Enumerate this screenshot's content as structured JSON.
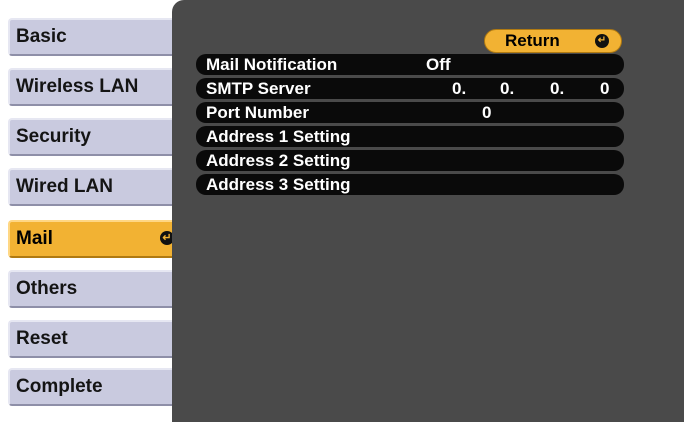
{
  "sidebar": {
    "items": [
      {
        "label": "Basic"
      },
      {
        "label": "Wireless LAN"
      },
      {
        "label": "Security"
      },
      {
        "label": "Wired LAN"
      },
      {
        "label": "Mail"
      },
      {
        "label": "Others"
      },
      {
        "label": "Reset"
      },
      {
        "label": "Complete"
      }
    ],
    "active_index": 4,
    "enter_icon": "enter-icon"
  },
  "panel": {
    "return_label": "Return",
    "return_icon": "return-icon",
    "rows": [
      {
        "label": "Mail Notification",
        "value": "Off"
      },
      {
        "label": "SMTP Server",
        "octets": [
          "0.",
          "0.",
          "0.",
          "0"
        ]
      },
      {
        "label": "Port Number",
        "value": "0"
      },
      {
        "label": "Address 1 Setting"
      },
      {
        "label": "Address 2 Setting"
      },
      {
        "label": "Address 3 Setting"
      }
    ]
  },
  "colors": {
    "tab_bg": "#c9cadf",
    "tab_active_bg": "#f2b233",
    "panel_bg": "#4a4a4a",
    "row_bg": "#0a0a0a",
    "text_light": "#ffffff"
  }
}
